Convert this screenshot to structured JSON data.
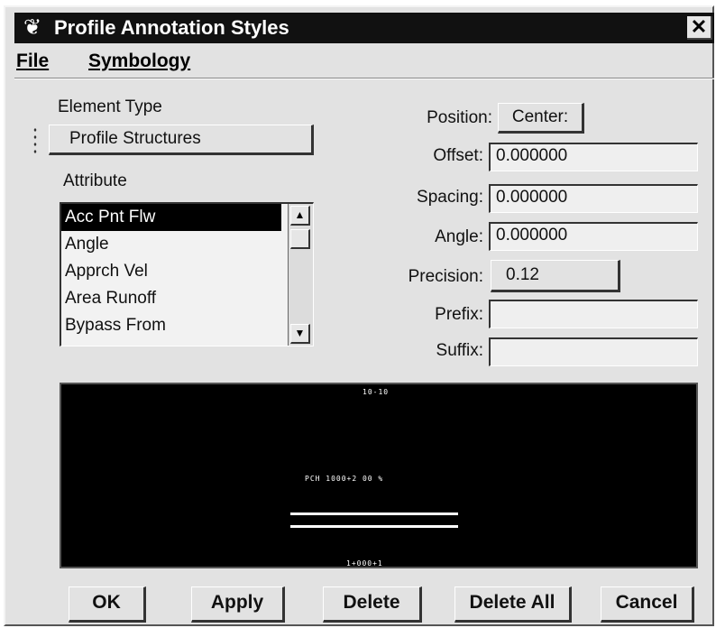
{
  "window": {
    "title": "Profile Annotation Styles",
    "close_glyph": "✕",
    "icon": "tree-icon"
  },
  "menu": [
    {
      "label": "File"
    },
    {
      "label": "Symbology"
    }
  ],
  "element_type": {
    "label": "Element Type",
    "value": "Profile Structures"
  },
  "attribute": {
    "label": "Attribute",
    "items": [
      "Acc Pnt Flw",
      "Angle",
      "Apprch Vel",
      "Area Runoff",
      "Bypass From"
    ],
    "selected_index": 0
  },
  "fields": {
    "position": {
      "label": "Position:",
      "value": "Center:"
    },
    "offset": {
      "label": "Offset:",
      "value": "0.000000"
    },
    "spacing": {
      "label": "Spacing:",
      "value": "0.000000"
    },
    "angle": {
      "label": "Angle:",
      "value": "0.000000"
    },
    "precision": {
      "label": "Precision:",
      "value": "0.12"
    },
    "prefix": {
      "label": "Prefix:",
      "value": ""
    },
    "suffix": {
      "label": "Suffix:",
      "value": ""
    }
  },
  "preview": {
    "top_text": "10-10",
    "middle_text": "PCH 1000+2 00 %",
    "bottom_text": "1+000+1"
  },
  "buttons": {
    "ok": "OK",
    "apply": "Apply",
    "delete": "Delete",
    "delete_all": "Delete All",
    "cancel": "Cancel"
  },
  "colors": {
    "titlebar": "#111111",
    "dialog": "#e2e2e2",
    "preview_bg": "#000000",
    "selection": "#000000"
  }
}
